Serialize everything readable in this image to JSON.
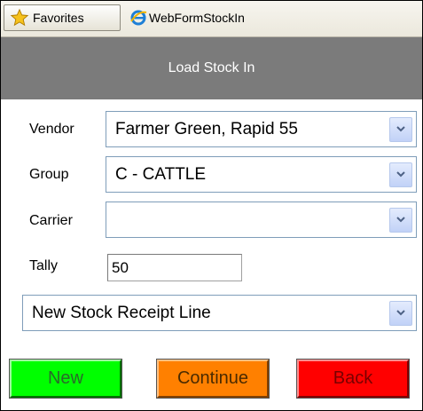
{
  "favorites_bar": {
    "favorites_label": "Favorites",
    "tab_title": "WebFormStockIn",
    "favorites_icon": "star-icon",
    "tab_icon": "ie-browser-icon"
  },
  "header": {
    "title": "Load Stock In"
  },
  "form": {
    "vendor_label": "Vendor",
    "vendor_value": "Farmer Green, Rapid 55",
    "group_label": "Group",
    "group_value": "C - CATTLE",
    "carrier_label": "Carrier",
    "carrier_value": "",
    "tally_label": "Tally",
    "tally_value": "50",
    "receipt_value": "New Stock Receipt Line"
  },
  "buttons": {
    "new": "New",
    "continue": "Continue",
    "back": "Back"
  },
  "colors": {
    "header_bg": "#7b7b7b",
    "new_button": "#00ff00",
    "continue_button": "#ff8000",
    "back_button": "#ff0000"
  }
}
